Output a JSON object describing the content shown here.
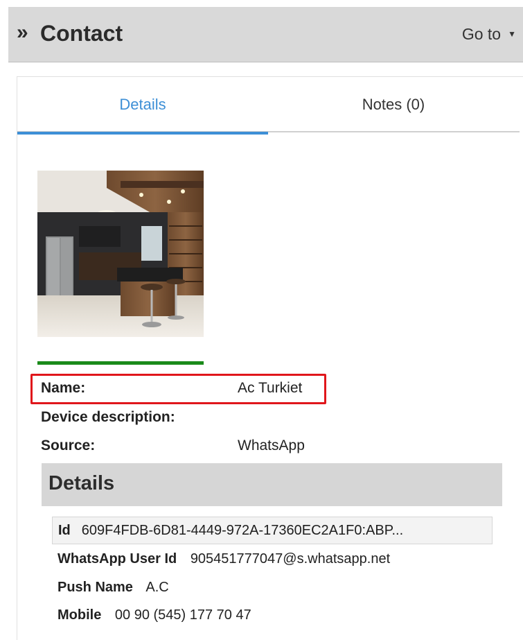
{
  "header": {
    "title": "Contact",
    "goto_label": "Go to"
  },
  "tabs": [
    {
      "label": "Details",
      "active": true
    },
    {
      "label": "Notes (0)",
      "active": false
    }
  ],
  "contact": {
    "photo_icon": "contact-photo",
    "name_label": "Name:",
    "name_value": "Ac Turkiet",
    "device_label": "Device description:",
    "device_value": "",
    "source_label": "Source:",
    "source_value": "WhatsApp"
  },
  "details": {
    "title": "Details",
    "id_label": "Id",
    "id_value": "609F4FDB-6D81-4449-972A-17360EC2A1F0:ABP...",
    "whatsapp_label": "WhatsApp User Id",
    "whatsapp_value": "905451777047@s.whatsapp.net",
    "push_label": "Push Name",
    "push_value": "A.C",
    "mobile_label": "Mobile",
    "mobile_value": "00 90 (545) 177 70 47"
  },
  "colors": {
    "accent": "#3d8fd6",
    "highlight": "#e0161b",
    "status_bar": "#1a8a1a"
  }
}
